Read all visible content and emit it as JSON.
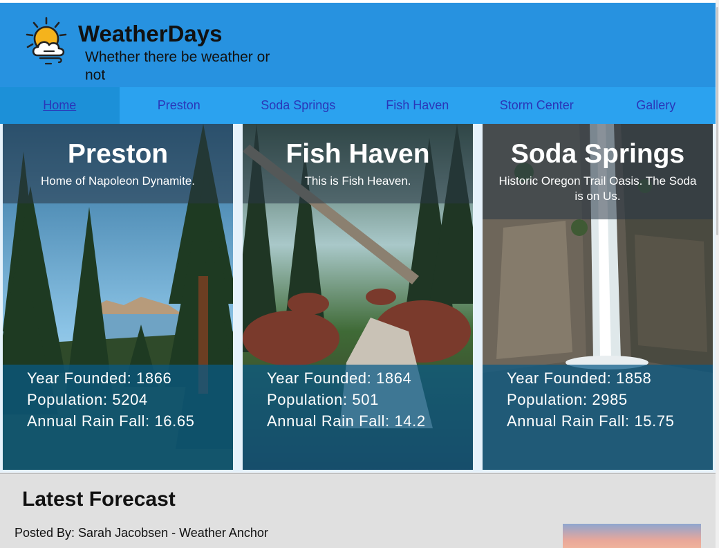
{
  "header": {
    "title": "WeatherDays",
    "tagline": "Whether there be weather or not"
  },
  "nav": {
    "items": [
      "Home",
      "Preston",
      "Soda Springs",
      "Fish Haven",
      "Storm Center",
      "Gallery"
    ]
  },
  "cards": [
    {
      "city": "Preston",
      "motto": "Home of Napoleon Dynamite.",
      "year_founded": "Year Founded: 1866",
      "population": "Population: 5204",
      "rain": "Annual Rain Fall: 16.65"
    },
    {
      "city": "Fish Haven",
      "motto": "This is Fish Heaven.",
      "year_founded": "Year Founded: 1864",
      "population": "Population: 501",
      "rain": "Annual Rain Fall: 14.2"
    },
    {
      "city": "Soda Springs",
      "motto": "Historic Oregon Trail Oasis. The Soda is on Us.",
      "year_founded": "Year Founded: 1858",
      "population": "Population: 2985",
      "rain": "Annual Rain Fall: 15.75"
    }
  ],
  "forecast": {
    "heading": "Latest Forecast",
    "posted_by": "Posted By: Sarah Jacobsen - Weather Anchor"
  },
  "colors": {
    "header_bg": "#2792e0",
    "nav_bg": "#2ba2ef",
    "nav_link": "#2a36b8",
    "stats_overlay": "#085a87"
  },
  "icons": {
    "logo": "sun-cloud-wind-icon"
  }
}
